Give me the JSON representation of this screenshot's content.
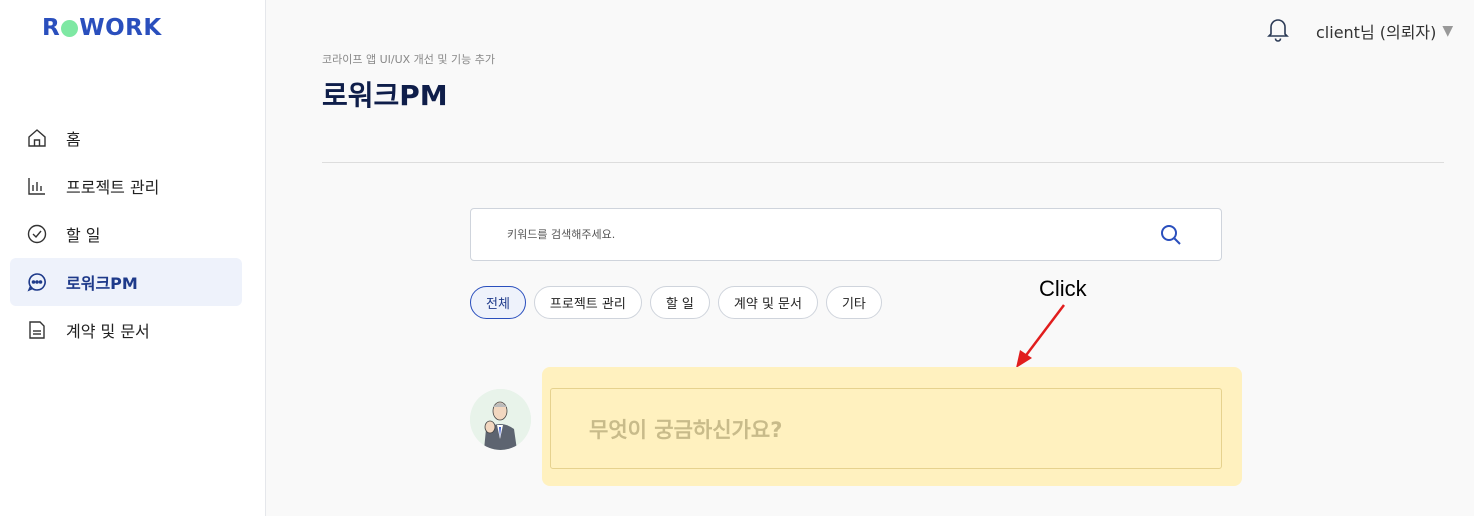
{
  "sidebar": {
    "logo": {
      "prefix": "R",
      "suffix": "WORK"
    },
    "items": [
      {
        "label": "홈",
        "icon": "home-icon",
        "active": false
      },
      {
        "label": "프로젝트 관리",
        "icon": "chart-icon",
        "active": false
      },
      {
        "label": "할 일",
        "icon": "check-circle-icon",
        "active": false
      },
      {
        "label": "로워크PM",
        "icon": "chat-bubble-icon",
        "active": true
      },
      {
        "label": "계약 및 문서",
        "icon": "document-icon",
        "active": false
      }
    ]
  },
  "topbar": {
    "bell_icon": "bell-icon",
    "user_label": "client님 (의뢰자)",
    "caret": "▼"
  },
  "header": {
    "breadcrumb": "코라이프 앱 UI/UX 개선 및 기능 추가",
    "title": "로워크PM"
  },
  "search": {
    "placeholder": "키워드를 검색해주세요.",
    "value": ""
  },
  "filters": [
    {
      "label": "전체",
      "active": true
    },
    {
      "label": "프로젝트 관리",
      "active": false
    },
    {
      "label": "할 일",
      "active": false
    },
    {
      "label": "계약 및 문서",
      "active": false
    },
    {
      "label": "기타",
      "active": false
    }
  ],
  "annotation": {
    "label": "Click"
  },
  "chat": {
    "prompt": "무엇이 궁금하신가요?"
  },
  "colors": {
    "brand": "#2a4fbd",
    "logo_dot": "#7ee8a3",
    "active_bg": "#eef2fb",
    "chat_bg": "#fff1bf",
    "arrow": "#e11d1d"
  }
}
